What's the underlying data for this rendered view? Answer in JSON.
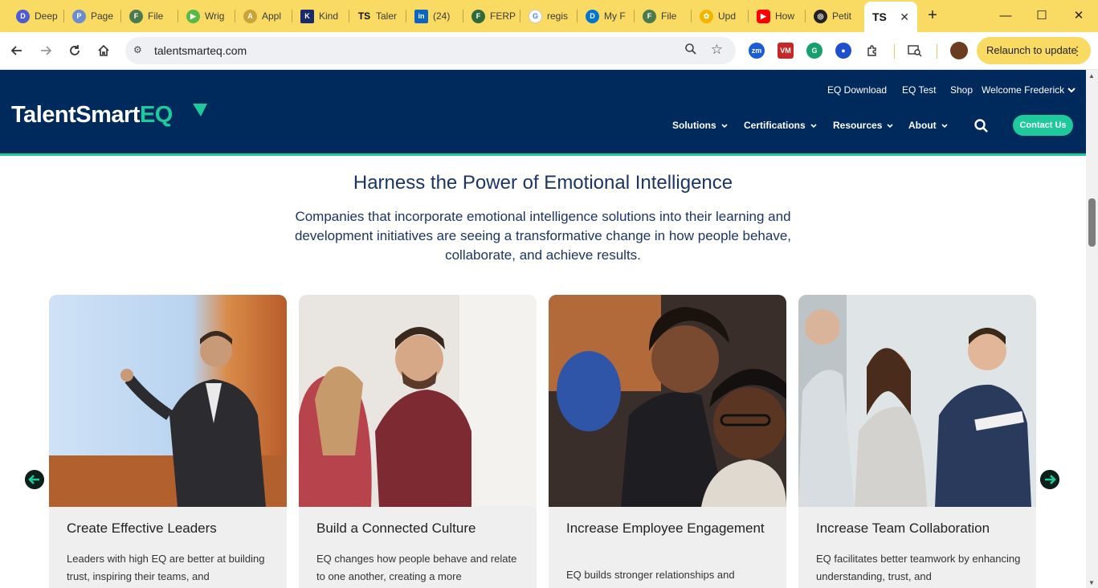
{
  "browser": {
    "tabs": [
      {
        "label": "Deep",
        "icon": "deepl-icon",
        "color": "#4f5bd5"
      },
      {
        "label": "Page",
        "icon": "page-icon",
        "color": "#6b8cce"
      },
      {
        "label": "File",
        "icon": "file-icon",
        "color": "#4c7a4c"
      },
      {
        "label": "Wrig",
        "icon": "play-icon",
        "color": "#58b947"
      },
      {
        "label": "Appl",
        "icon": "app-icon",
        "color": "#c9a43a"
      },
      {
        "label": "Kind",
        "icon": "kindle-icon",
        "color": "#1a2a6b"
      },
      {
        "label": "Taler",
        "icon": "ts-icon",
        "color": "#002a5c"
      },
      {
        "label": "(24)",
        "icon": "linkedin-icon",
        "color": "#0a66c2"
      },
      {
        "label": "FERP",
        "icon": "ferp-icon",
        "color": "#2e6b3a"
      },
      {
        "label": "regis",
        "icon": "google-icon",
        "color": "#4285f4"
      },
      {
        "label": "My F",
        "icon": "dell-icon",
        "color": "#0076ce"
      },
      {
        "label": "File",
        "icon": "file-icon",
        "color": "#4c7a4c"
      },
      {
        "label": "Upd",
        "icon": "photos-icon",
        "color": "#f4b400"
      },
      {
        "label": "How",
        "icon": "youtube-icon",
        "color": "#ff0000"
      },
      {
        "label": "Petit",
        "icon": "openai-icon",
        "color": "#222222"
      }
    ],
    "active_tab": {
      "label": "TS",
      "close": "✕"
    },
    "new_tab": "+",
    "window_controls": {
      "minimize": "—",
      "maximize": "☐",
      "close": "✕"
    },
    "url": "talentsmarteq.com",
    "relaunch_label": "Relaunch to update",
    "extensions": [
      "zm",
      "VM",
      "G",
      "●"
    ]
  },
  "site": {
    "logo_main": "TalentSmart",
    "logo_eq": "EQ",
    "utility_links": [
      "EQ Download",
      "EQ Test",
      "Shop"
    ],
    "welcome": "Welcome Frederick",
    "nav": [
      "Solutions",
      "Certifications",
      "Resources",
      "About"
    ],
    "contact": "Contact Us",
    "colors": {
      "navy": "#002a5c",
      "accent": "#1ec99c"
    }
  },
  "hero": {
    "title": "Harness the Power of Emotional Intelligence",
    "subtitle": "Companies that incorporate emotional intelligence solutions into their learning and development initiatives are seeing a transformative change in how people behave, collaborate, and achieve results."
  },
  "cards": [
    {
      "title": "Create Effective Leaders",
      "text": "Leaders with high EQ are better at building trust, inspiring their teams, and"
    },
    {
      "title": "Build a Connected Culture",
      "text": "EQ changes how people behave and relate to one another, creating a more"
    },
    {
      "title": "Increase Employee Engagement",
      "text": "EQ builds stronger relationships and"
    },
    {
      "title": "Increase Team Collaboration",
      "text": "EQ facilitates better teamwork by enhancing understanding, trust, and"
    }
  ]
}
